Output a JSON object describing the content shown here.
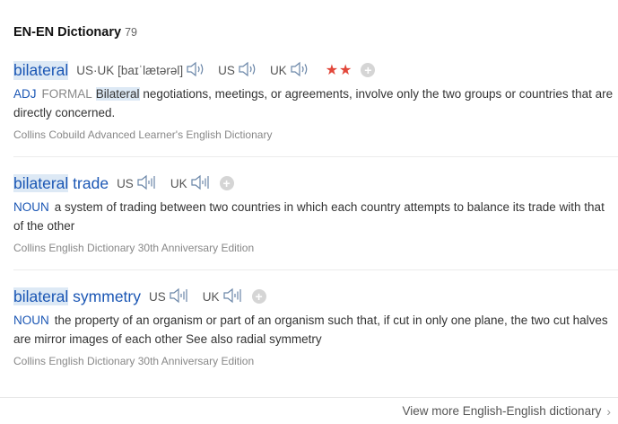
{
  "header": {
    "title": "EN-EN Dictionary",
    "count": "79"
  },
  "entries": [
    {
      "word_part1": "bilateral",
      "word_part2": "",
      "phonetic_label": "US·UK",
      "phonetic": "[baɪˈlætərəl]",
      "us_label": "US",
      "uk_label": "UK",
      "stars": "★★",
      "pos": "ADJ",
      "register": "FORMAL",
      "def_highlight": "Bilateral",
      "definition": " negotiations, meetings, or agreements, involve only the two groups or countries that are directly concerned.",
      "source": "Collins Cobuild Advanced Learner's English Dictionary"
    },
    {
      "word_part1": "bilateral",
      "word_part2": "trade",
      "us_label": "US",
      "uk_label": "UK",
      "pos": "NOUN",
      "definition": "a system of trading between two countries in which each country attempts to balance its trade with that of the other",
      "source": "Collins English Dictionary 30th Anniversary Edition"
    },
    {
      "word_part1": "bilateral",
      "word_part2": "symmetry",
      "us_label": "US",
      "uk_label": "UK",
      "pos": "NOUN",
      "definition": "the property of an organism or part of an organism such that, if cut in only one plane, the two cut halves are mirror images of each other See also radial symmetry",
      "source": "Collins English Dictionary 30th Anniversary Edition"
    }
  ],
  "footer": {
    "more_link": "View more English-English dictionary",
    "chevron": "›"
  },
  "icons": {
    "plus": "+",
    "speaker_color": "#6a86a8"
  },
  "colors": {
    "link": "#1a56b4",
    "star": "#e2473a",
    "highlight": "#dde9f5"
  }
}
